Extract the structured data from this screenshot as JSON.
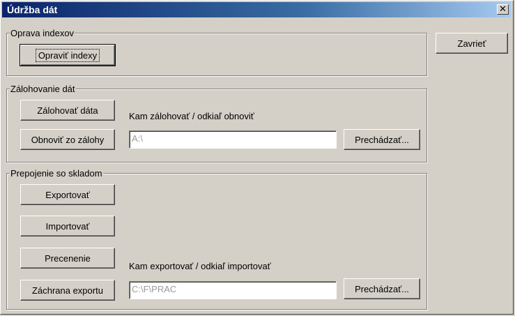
{
  "window": {
    "title": "Údržba dát"
  },
  "close_button": {
    "label": "Zavrieť"
  },
  "repair_group": {
    "legend": "Oprava indexov",
    "repair_button": "Opraviť indexy"
  },
  "backup_group": {
    "legend": "Zálohovanie dát",
    "backup_button": "Zálohovať dáta",
    "restore_button": "Obnoviť zo zálohy",
    "path_label": "Kam zálohovať / odkiaľ obnoviť",
    "path_value": "A:\\",
    "browse_button": "Prechádzať..."
  },
  "stock_group": {
    "legend": "Prepojenie so skladom",
    "export_button": "Exportovať",
    "import_button": "Importovať",
    "reprice_button": "Precenenie",
    "rescue_button": "Záchrana exportu",
    "path_label": "Kam exportovať / odkiaľ importovať",
    "path_value": "C:\\F\\PRAC",
    "browse_button": "Prechádzať..."
  }
}
